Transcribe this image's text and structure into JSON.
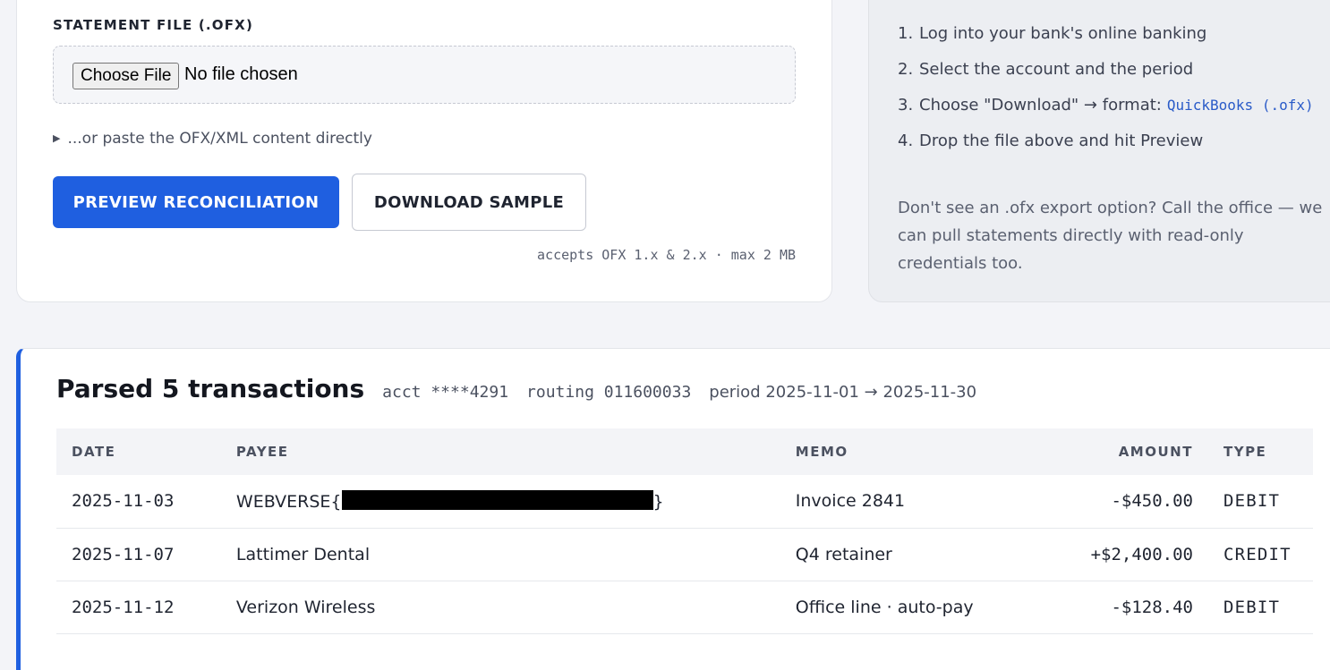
{
  "upload": {
    "field_label": "STATEMENT FILE (.OFX)",
    "choose_button": "Choose File",
    "no_file_text": "No file chosen",
    "paste_toggle": "...or paste the OFX/XML content directly",
    "preview_button": "PREVIEW RECONCILIATION",
    "sample_button": "DOWNLOAD SAMPLE",
    "accepts_text": "accepts OFX 1.x & 2.x · max 2 MB"
  },
  "help": {
    "steps": [
      {
        "num": "1.",
        "text": "Log into your bank's online banking"
      },
      {
        "num": "2.",
        "text": "Select the account and the period"
      },
      {
        "num": "3.",
        "text": "Choose \"Download\" → format:",
        "code": "QuickBooks (.ofx)"
      },
      {
        "num": "4.",
        "text": "Drop the file above and hit Preview"
      }
    ],
    "note": "Don't see an .ofx export option? Call the office — we can pull statements directly with read-only credentials too."
  },
  "results": {
    "title": "Parsed 5 transactions",
    "acct": "acct ****4291",
    "routing": "routing 011600033",
    "period": "period 2025-11-01 → 2025-11-30",
    "columns": {
      "date": "DATE",
      "payee": "PAYEE",
      "memo": "MEMO",
      "amount": "AMOUNT",
      "type": "TYPE"
    },
    "rows": [
      {
        "date": "2025-11-03",
        "payee_prefix": "WEBVERSE{",
        "payee_suffix": "}",
        "memo": "Invoice 2841",
        "amount": "-$450.00",
        "type": "DEBIT"
      },
      {
        "date": "2025-11-07",
        "payee": "Lattimer Dental",
        "memo": "Q4 retainer",
        "amount": "+$2,400.00",
        "type": "CREDIT"
      },
      {
        "date": "2025-11-12",
        "payee": "Verizon Wireless",
        "memo": "Office line · auto-pay",
        "amount": "-$128.40",
        "type": "DEBIT"
      }
    ]
  },
  "colors": {
    "accent": "#1f5fe0",
    "debit": "#c0344a",
    "credit": "#1f8a5c"
  }
}
